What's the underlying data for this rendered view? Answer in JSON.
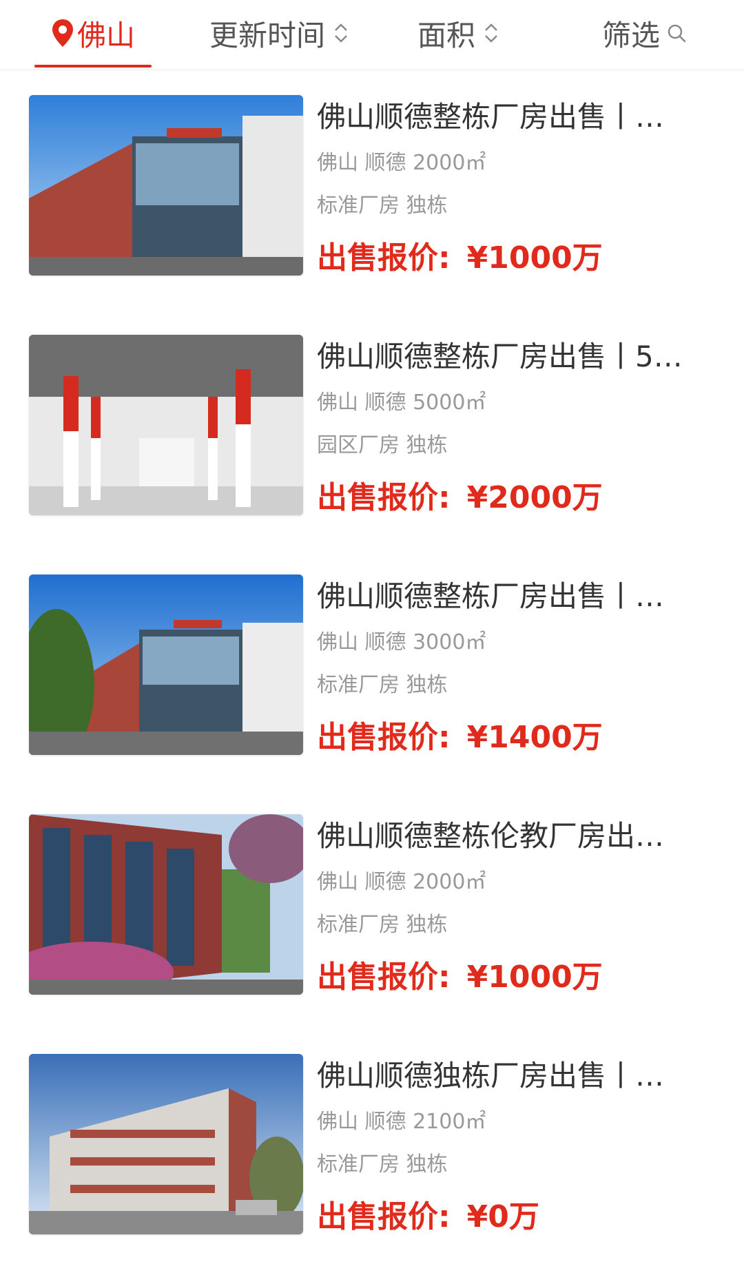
{
  "filter_bar": {
    "city": "佛山",
    "sort_update": "更新时间",
    "sort_area": "面积",
    "filter": "筛选"
  },
  "listings": [
    {
      "title": "佛山顺德整栋厂房出售丨…",
      "location": "佛山 顺德 2000㎡",
      "tags": "标准厂房 独栋",
      "price_label": "出售报价:",
      "price_value": "¥1000万"
    },
    {
      "title": "佛山顺德整栋厂房出售丨5…",
      "location": "佛山 顺德 5000㎡",
      "tags": "园区厂房 独栋",
      "price_label": "出售报价:",
      "price_value": "¥2000万"
    },
    {
      "title": "佛山顺德整栋厂房出售丨…",
      "location": "佛山 顺德 3000㎡",
      "tags": "标准厂房 独栋",
      "price_label": "出售报价:",
      "price_value": "¥1400万"
    },
    {
      "title": "佛山顺德整栋伦教厂房出…",
      "location": "佛山 顺德 2000㎡",
      "tags": "标准厂房 独栋",
      "price_label": "出售报价:",
      "price_value": "¥1000万"
    },
    {
      "title": "佛山顺德独栋厂房出售丨…",
      "location": "佛山 顺德 2100㎡",
      "tags": "标准厂房 独栋",
      "price_label": "出售报价:",
      "price_value": "¥0万"
    }
  ],
  "icons": {
    "location": "location-pin-icon",
    "sort": "sort-updown-icon",
    "search": "search-icon"
  },
  "colors": {
    "accent": "#e02a1c",
    "text": "#333333",
    "muted": "#999999"
  }
}
